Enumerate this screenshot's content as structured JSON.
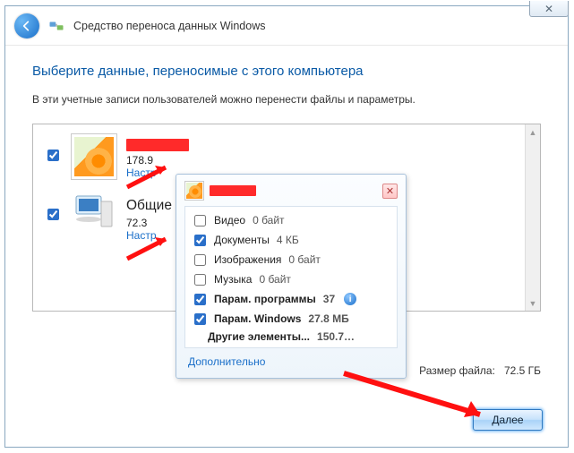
{
  "window": {
    "close_glyph": "✕",
    "title": "Средство переноса данных Windows"
  },
  "page": {
    "heading": "Выберите данные, переносимые с этого компьютера",
    "subtext": "В эти учетные записи пользователей можно перенести файлы и параметры."
  },
  "entries": [
    {
      "checked": true,
      "name": "[user]",
      "size": "178.9",
      "customize": "Настр"
    },
    {
      "checked": true,
      "name": "Общие",
      "size": "72.3",
      "customize": "Настр"
    }
  ],
  "popup": {
    "rows": [
      {
        "checked": false,
        "label": "Видео",
        "value": "0 байт",
        "bold": false
      },
      {
        "checked": true,
        "label": "Документы",
        "value": "4 КБ",
        "bold": false
      },
      {
        "checked": false,
        "label": "Изображения",
        "value": "0 байт",
        "bold": false
      },
      {
        "checked": false,
        "label": "Музыка",
        "value": "0 байт",
        "bold": false
      },
      {
        "checked": true,
        "label": "Парам. программы",
        "value": "37",
        "bold": true,
        "info": true
      },
      {
        "checked": true,
        "label": "Парам. Windows",
        "value": "27.8 МБ",
        "bold": true
      },
      {
        "checked": null,
        "label": "Другие элементы...",
        "value": "150.7…",
        "bold": true
      }
    ],
    "more_link": "Дополнительно"
  },
  "footer": {
    "size_label": "Размер файла:",
    "size_value": "72.5 ГБ",
    "next": "Далее"
  }
}
